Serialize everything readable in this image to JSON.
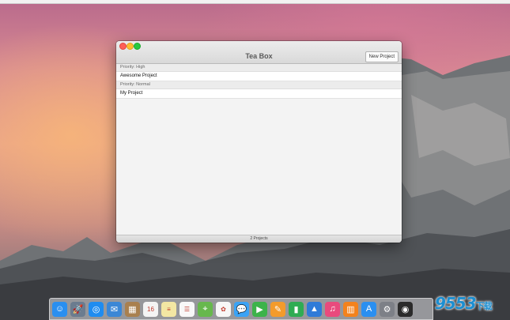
{
  "window": {
    "title": "Tea Box",
    "new_project_label": "New Project",
    "status": "2 Projects",
    "sections": [
      {
        "header": "Priority: High",
        "items": [
          "Awesome Project"
        ]
      },
      {
        "header": "Priority: Normal",
        "items": [
          "My Project"
        ]
      }
    ]
  },
  "dock": {
    "apps": [
      {
        "name": "finder-icon",
        "color": "#2a8ff0",
        "glyph": "☺"
      },
      {
        "name": "launchpad-icon",
        "color": "#6b7c8f",
        "glyph": "🚀"
      },
      {
        "name": "safari-icon",
        "color": "#1f8cf0",
        "glyph": "◎"
      },
      {
        "name": "mail-icon",
        "color": "#3b87d6",
        "glyph": "✉"
      },
      {
        "name": "contacts-icon",
        "color": "#a9804f",
        "glyph": "▦"
      },
      {
        "name": "calendar-icon",
        "color": "#f4f4f4",
        "glyph": "16"
      },
      {
        "name": "notes-icon",
        "color": "#f3e7a3",
        "glyph": "≡"
      },
      {
        "name": "reminders-icon",
        "color": "#f8f8f8",
        "glyph": "☰"
      },
      {
        "name": "maps-icon",
        "color": "#67b84d",
        "glyph": "⌖"
      },
      {
        "name": "photos-icon",
        "color": "#f7f7f7",
        "glyph": "✿"
      },
      {
        "name": "messages-icon",
        "color": "#3aa3f5",
        "glyph": "💬"
      },
      {
        "name": "facetime-icon",
        "color": "#3cb34a",
        "glyph": "▶"
      },
      {
        "name": "pages-icon",
        "color": "#f39b2c",
        "glyph": "✎"
      },
      {
        "name": "numbers-icon",
        "color": "#2eac53",
        "glyph": "▮"
      },
      {
        "name": "keynote-icon",
        "color": "#2f7bd8",
        "glyph": "▲"
      },
      {
        "name": "itunes-icon",
        "color": "#e94a7d",
        "glyph": "♫"
      },
      {
        "name": "ibooks-icon",
        "color": "#f3821c",
        "glyph": "▥"
      },
      {
        "name": "app-store-icon",
        "color": "#2a8ff0",
        "glyph": "A"
      },
      {
        "name": "system-preferences-icon",
        "color": "#7d8087",
        "glyph": "⚙"
      },
      {
        "name": "activity-monitor-icon",
        "color": "#2b2b2b",
        "glyph": "◉"
      }
    ]
  },
  "watermark": {
    "main": "9553",
    "sub": "下载"
  }
}
